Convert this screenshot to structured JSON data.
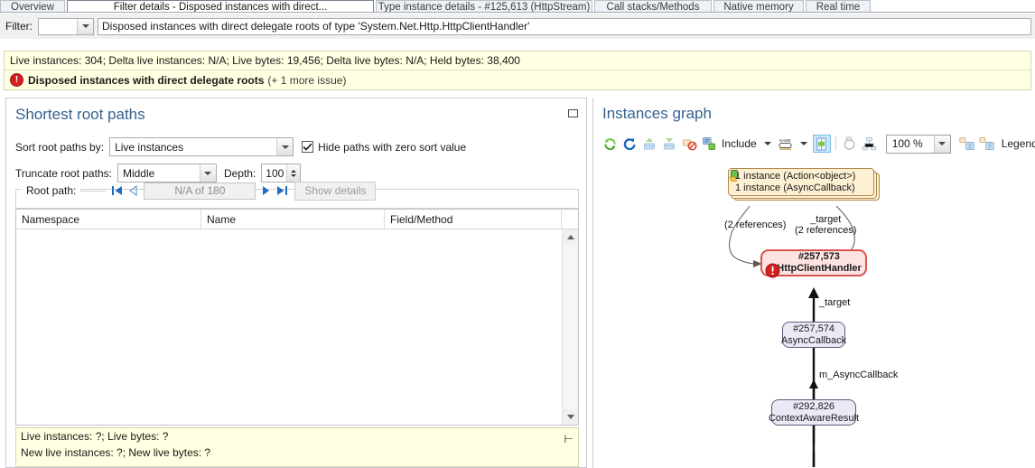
{
  "tabs": [
    {
      "label": "Overview",
      "selected": false
    },
    {
      "label": "Filter details - Disposed instances with direct...",
      "selected": true
    },
    {
      "label": "Type instance details - #125,613 (HttpStream)",
      "selected": false
    },
    {
      "label": "Call stacks/Methods",
      "selected": false
    },
    {
      "label": "Native memory",
      "selected": false
    },
    {
      "label": "Real time",
      "selected": false
    }
  ],
  "filter": {
    "label": "Filter:",
    "combo_value": "",
    "text_value": "Disposed instances with direct delegate roots of type 'System.Net.Http.HttpClientHandler'",
    "dropdown_icon": "chevron-down-icon"
  },
  "info": {
    "stats_line": "Live instances: 304; Delta live instances: N/A; Live bytes: 19,456; Delta live bytes: N/A; Held bytes: 38,400",
    "issue_icon": "error-icon",
    "issue_title": "Disposed instances with direct delegate roots",
    "issue_more": "(+ 1 more issue)"
  },
  "left_panel": {
    "title": "Shortest root paths",
    "restore_icon": "restore-window-icon",
    "sort_label": "Sort root paths by:",
    "sort_value": "Live instances",
    "hide_zero_label": "Hide paths with zero sort value",
    "hide_zero_checked": true,
    "truncate_label": "Truncate root paths:",
    "truncate_value": "Middle",
    "depth_label": "Depth:",
    "depth_value": "100",
    "rootpath_label": "Root path:",
    "nav_first_icon": "nav-first-icon",
    "nav_prev_icon": "nav-prev-icon",
    "nav_value": "N/A of 180",
    "nav_next_icon": "nav-next-icon",
    "nav_last_icon": "nav-last-icon",
    "show_details_label": "Show details",
    "columns": [
      "Namespace",
      "Name",
      "Field/Method"
    ],
    "rows": [],
    "status_line1": "Live instances: ?; Live bytes: ?",
    "status_line2": "New live instances: ?; New live bytes: ?",
    "pin_icon": "pin-icon"
  },
  "right_panel": {
    "title": "Instances graph",
    "toolbar": {
      "buttons": [
        {
          "name": "refresh-icon",
          "label": ""
        },
        {
          "name": "reload-icon",
          "label": ""
        },
        {
          "name": "expand-up-icon",
          "label": ""
        },
        {
          "name": "expand-down-icon",
          "label": ""
        },
        {
          "name": "remove-node-icon",
          "label": ""
        },
        {
          "name": "include-nodes-icon",
          "label": ""
        }
      ],
      "include_label": "Include",
      "include_caret": "chevron-down-icon",
      "name-style-icon": "label-style-icon",
      "name_style_caret": "chevron-down-icon",
      "fit-page-icon": "fit-to-page-icon",
      "circular-layout-icon": "circular-layout-icon",
      "tree-layout-icon": "tree-layout-icon",
      "zoom_value": "100 %",
      "zoom_caret": "chevron-down-icon",
      "split-left-icon": "split-pane-left-icon",
      "split-right-icon": "split-pane-right-icon",
      "legend_label": "Legend"
    }
  },
  "graph": {
    "nodes": [
      {
        "id": "roots",
        "kind": "stack",
        "icon": "root-instances-icon",
        "line1": "1 instance (Action<object>)",
        "line2": "1 instance (AsyncCallback)"
      },
      {
        "id": "httpclienthandler",
        "kind": "error",
        "icon": "error-icon",
        "line1": "#257,573",
        "line2": "HttpClientHandler"
      },
      {
        "id": "asynccallback",
        "kind": "plain",
        "line1": "#257,574",
        "line2": "AsyncCallback"
      },
      {
        "id": "contextawareresult",
        "kind": "plain",
        "line1": "#292,826",
        "line2": "ContextAwareResult"
      }
    ],
    "edge_labels": [
      {
        "id": "e1",
        "text": "(2 references)"
      },
      {
        "id": "e2_line1",
        "text": "_target"
      },
      {
        "id": "e2_line2",
        "text": "(2 references)"
      },
      {
        "id": "e3",
        "text": "_target"
      },
      {
        "id": "e4",
        "text": "m_AsyncCallback"
      }
    ]
  },
  "colors": {
    "accent": "#35618f",
    "info_bg": "#ffffe1",
    "error": "#d32020",
    "node_error_bg": "#fde3e1",
    "node_error_border": "#d9534f",
    "node_plain_bg": "#ece9f7",
    "node_stack_bg": "#fdf0d2",
    "toolbar_active": "#cde6f7"
  }
}
